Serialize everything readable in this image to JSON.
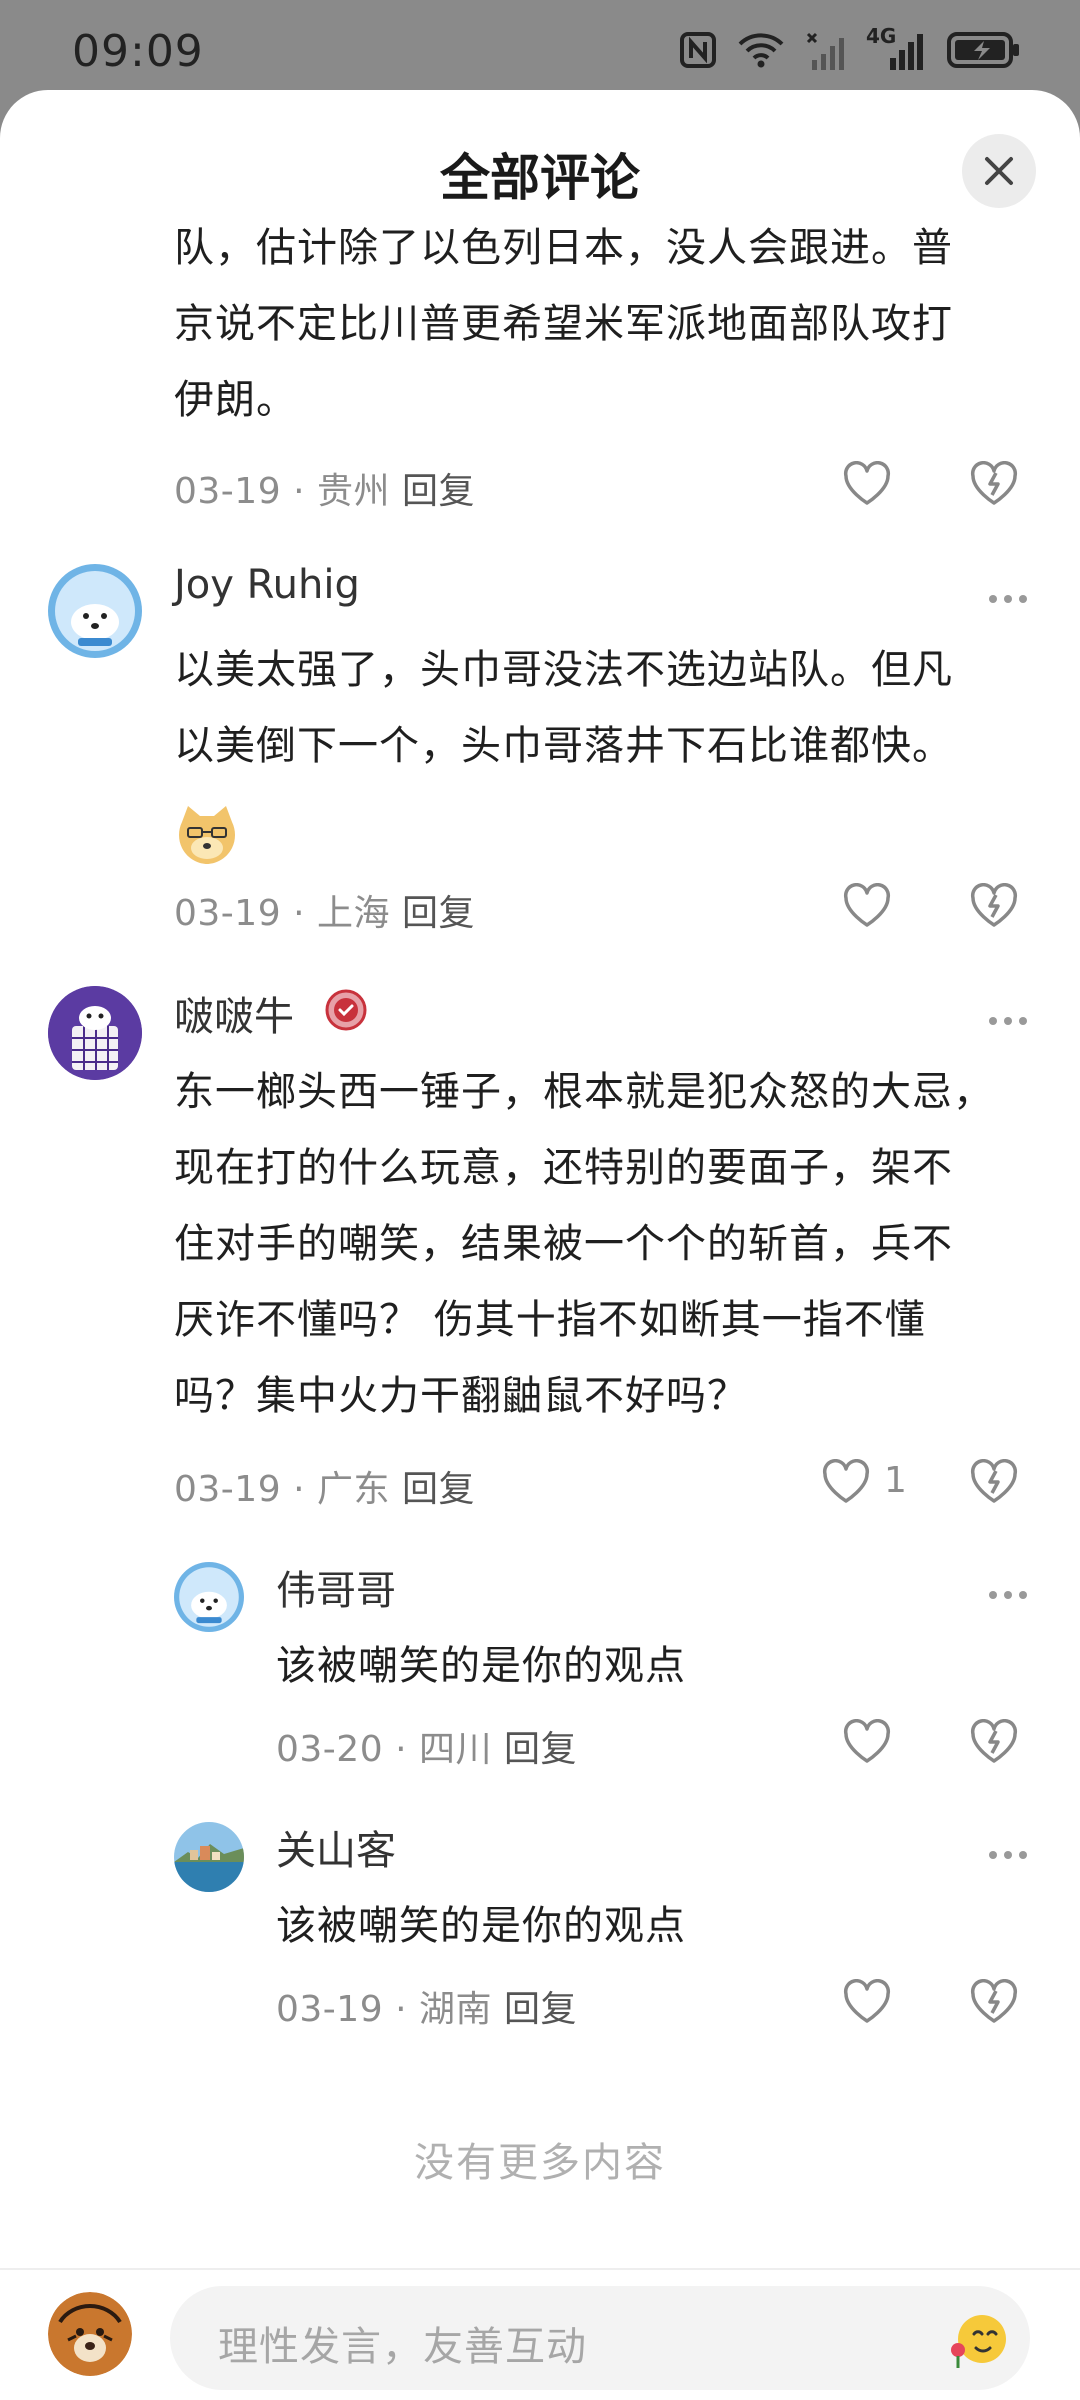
{
  "status_bar": {
    "time": "09:09",
    "network": "4G"
  },
  "sheet": {
    "title": "全部评论",
    "close_icon": "close-icon"
  },
  "comments": [
    {
      "text_lines": [
        "队，估计除了以色列日本，没人会跟进。普",
        "京说不定比川普更希望米军派地面部队攻打",
        "伊朗。"
      ],
      "date": "03-19",
      "location": "贵州",
      "reply": "回复"
    },
    {
      "name": "Joy Ruhig",
      "text_lines": [
        "以美太强了，头巾哥没法不选边站队。但凡",
        "以美倒下一个，头巾哥落井下石比谁都快。"
      ],
      "sticker": "doge-emoji",
      "date": "03-19",
      "location": "上海",
      "reply": "回复"
    },
    {
      "name": "啵啵牛",
      "badge": "verified-badge",
      "text_lines": [
        "东一榔头西一锤子，根本就是犯众怒的大忌，",
        "现在打的什么玩意，还特别的要面子，架不",
        "住对手的嘲笑，结果被一个个的斩首，兵不",
        "厌诈不懂吗？ 伤其十指不如断其一指不懂",
        "吗？集中火力干翻鼬鼠不好吗？"
      ],
      "date": "03-19",
      "location": "广东",
      "reply": "回复",
      "likes": "1"
    }
  ],
  "replies": [
    {
      "name": "伟哥哥",
      "text": "该被嘲笑的是你的观点",
      "date": "03-20",
      "location": "四川",
      "reply": "回复"
    },
    {
      "name": "关山客",
      "text": "该被嘲笑的是你的观点",
      "date": "03-19",
      "location": "湖南",
      "reply": "回复"
    }
  ],
  "separator": "·",
  "no_more": "没有更多内容",
  "input": {
    "placeholder": "理性发言，友善互动"
  },
  "colors": {
    "status_bg": "#8a8a8a",
    "meta_gray": "#8c8c8c",
    "verified_red": "#c8323c",
    "avatar_blue": "#6fb4e6"
  }
}
